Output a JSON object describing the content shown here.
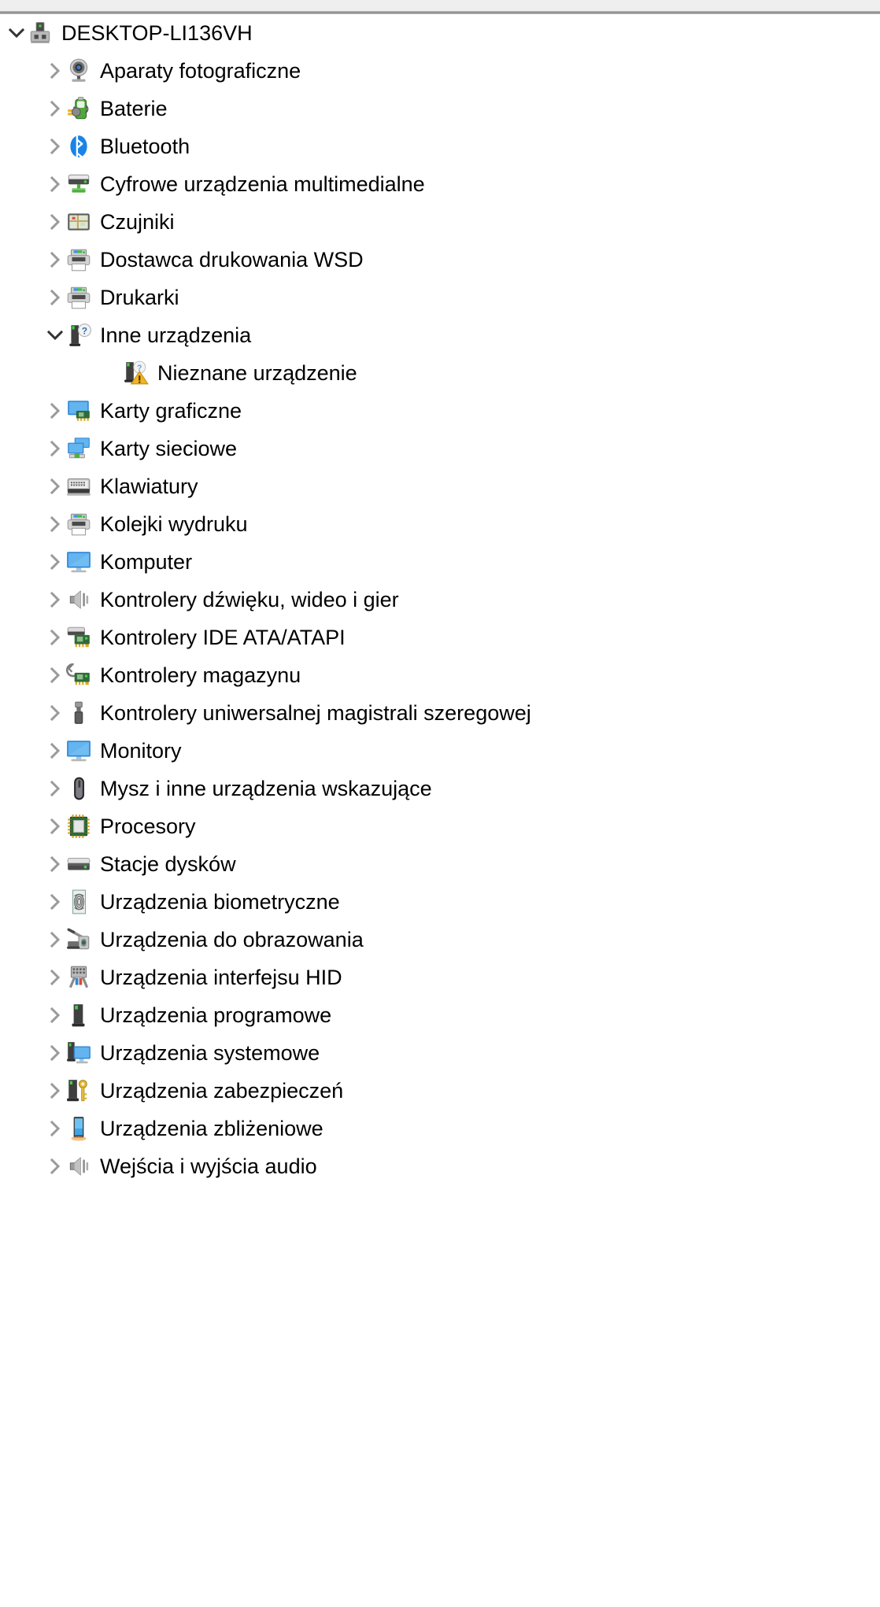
{
  "window": {
    "title_bar_color": "#efefef",
    "background_color": "#ffffff",
    "text_color": "#000000"
  },
  "tree": {
    "root": {
      "label": "DESKTOP-LI136VH",
      "icon": "computer-node-icon",
      "expanded": true,
      "level": 0
    },
    "items": [
      {
        "label": "Aparaty fotograficzne",
        "icon": "camera-icon",
        "expanded": false,
        "level": 1,
        "has_children": true
      },
      {
        "label": "Baterie",
        "icon": "battery-icon",
        "expanded": false,
        "level": 1,
        "has_children": true
      },
      {
        "label": "Bluetooth",
        "icon": "bluetooth-icon",
        "expanded": false,
        "level": 1,
        "has_children": true
      },
      {
        "label": "Cyfrowe urządzenia multimedialne",
        "icon": "media-device-icon",
        "expanded": false,
        "level": 1,
        "has_children": true
      },
      {
        "label": "Czujniki",
        "icon": "sensor-icon",
        "expanded": false,
        "level": 1,
        "has_children": true
      },
      {
        "label": "Dostawca drukowania WSD",
        "icon": "printer-icon",
        "expanded": false,
        "level": 1,
        "has_children": true
      },
      {
        "label": "Drukarki",
        "icon": "printer-icon",
        "expanded": false,
        "level": 1,
        "has_children": true
      },
      {
        "label": "Inne urządzenia",
        "icon": "unknown-device-icon",
        "expanded": true,
        "level": 1,
        "has_children": true
      },
      {
        "label": "Nieznane urządzenie",
        "icon": "unknown-device-warning-icon",
        "expanded": false,
        "level": 2,
        "has_children": false
      },
      {
        "label": "Karty graficzne",
        "icon": "display-adapter-icon",
        "expanded": false,
        "level": 1,
        "has_children": true
      },
      {
        "label": "Karty sieciowe",
        "icon": "network-adapter-icon",
        "expanded": false,
        "level": 1,
        "has_children": true
      },
      {
        "label": "Klawiatury",
        "icon": "keyboard-icon",
        "expanded": false,
        "level": 1,
        "has_children": true
      },
      {
        "label": "Kolejki wydruku",
        "icon": "printer-icon",
        "expanded": false,
        "level": 1,
        "has_children": true
      },
      {
        "label": "Komputer",
        "icon": "monitor-icon",
        "expanded": false,
        "level": 1,
        "has_children": true
      },
      {
        "label": "Kontrolery dźwięku, wideo i gier",
        "icon": "speaker-icon",
        "expanded": false,
        "level": 1,
        "has_children": true
      },
      {
        "label": "Kontrolery IDE ATA/ATAPI",
        "icon": "ide-controller-icon",
        "expanded": false,
        "level": 1,
        "has_children": true
      },
      {
        "label": "Kontrolery magazynu",
        "icon": "storage-controller-icon",
        "expanded": false,
        "level": 1,
        "has_children": true
      },
      {
        "label": "Kontrolery uniwersalnej magistrali szeregowej",
        "icon": "usb-icon",
        "expanded": false,
        "level": 1,
        "has_children": true
      },
      {
        "label": "Monitory",
        "icon": "monitor-icon",
        "expanded": false,
        "level": 1,
        "has_children": true
      },
      {
        "label": "Mysz i inne urządzenia wskazujące",
        "icon": "mouse-icon",
        "expanded": false,
        "level": 1,
        "has_children": true
      },
      {
        "label": "Procesory",
        "icon": "processor-icon",
        "expanded": false,
        "level": 1,
        "has_children": true
      },
      {
        "label": "Stacje dysków",
        "icon": "disk-drive-icon",
        "expanded": false,
        "level": 1,
        "has_children": true
      },
      {
        "label": "Urządzenia biometryczne",
        "icon": "fingerprint-icon",
        "expanded": false,
        "level": 1,
        "has_children": true
      },
      {
        "label": "Urządzenia do obrazowania",
        "icon": "scanner-icon",
        "expanded": false,
        "level": 1,
        "has_children": true
      },
      {
        "label": "Urządzenia interfejsu HID",
        "icon": "hid-icon",
        "expanded": false,
        "level": 1,
        "has_children": true
      },
      {
        "label": "Urządzenia programowe",
        "icon": "software-device-icon",
        "expanded": false,
        "level": 1,
        "has_children": true
      },
      {
        "label": "Urządzenia systemowe",
        "icon": "system-device-icon",
        "expanded": false,
        "level": 1,
        "has_children": true
      },
      {
        "label": "Urządzenia zabezpieczeń",
        "icon": "security-device-icon",
        "expanded": false,
        "level": 1,
        "has_children": true
      },
      {
        "label": "Urządzenia zbliżeniowe",
        "icon": "proximity-device-icon",
        "expanded": false,
        "level": 1,
        "has_children": true
      },
      {
        "label": "Wejścia i wyjścia audio",
        "icon": "speaker-icon",
        "expanded": false,
        "level": 1,
        "has_children": true
      }
    ]
  }
}
